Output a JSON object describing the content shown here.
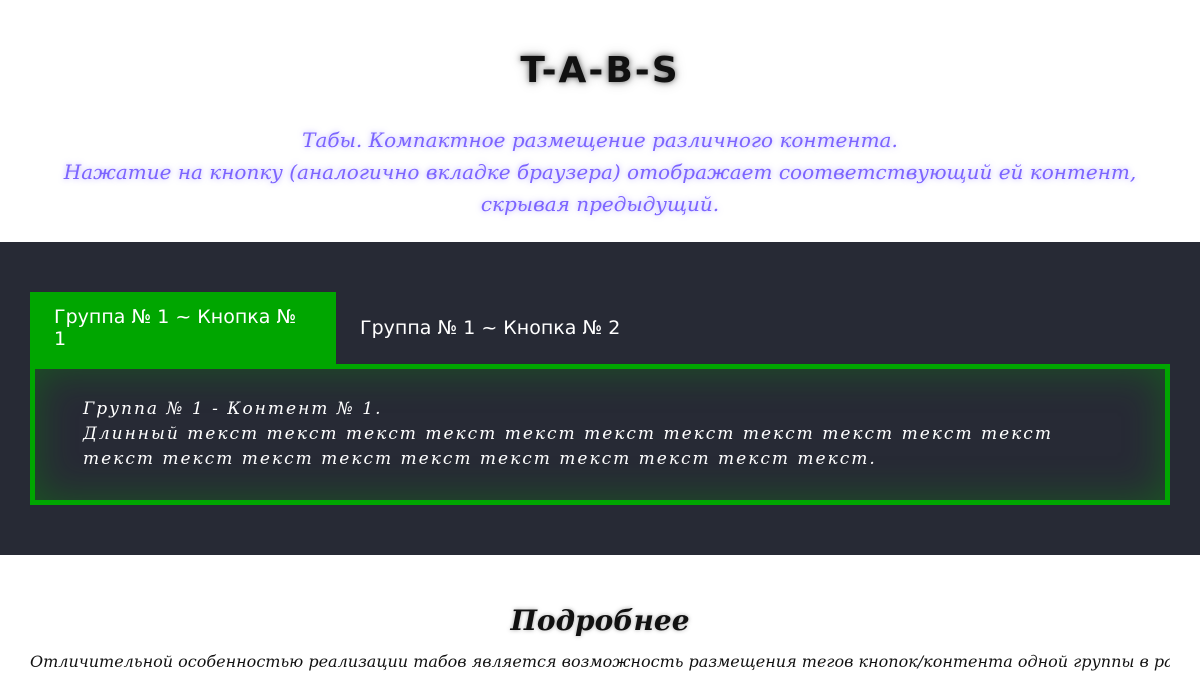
{
  "header": {
    "title": "T-A-B-S",
    "subtitle_line1": "Табы. Компактное размещение различного контента.",
    "subtitle_line2": "Нажатие на кнопку (аналогично вкладке браузера) отображает соответствующий ей контент, скрывая предыдущий."
  },
  "tabs": {
    "items": [
      {
        "label": "Группа № 1 ~ Кнопка № 1",
        "active": true
      },
      {
        "label": "Группа № 1 ~ Кнопка № 2",
        "active": false
      }
    ],
    "content": {
      "line1": "Группа № 1 - Контент № 1.",
      "line2": "Длинный текст текст текст текст текст текст текст текст текст текст текст текст текст текст текст текст текст текст текст текст текст."
    }
  },
  "more": {
    "title": "Подробнее",
    "text": "Отличительной особенностью реализации табов является возможность размещения тегов кнопок/контента одной группы в разных"
  },
  "colors": {
    "accent_green": "#00a600",
    "dark_bg": "#272a35",
    "subtitle_purple": "#7b64ff"
  }
}
